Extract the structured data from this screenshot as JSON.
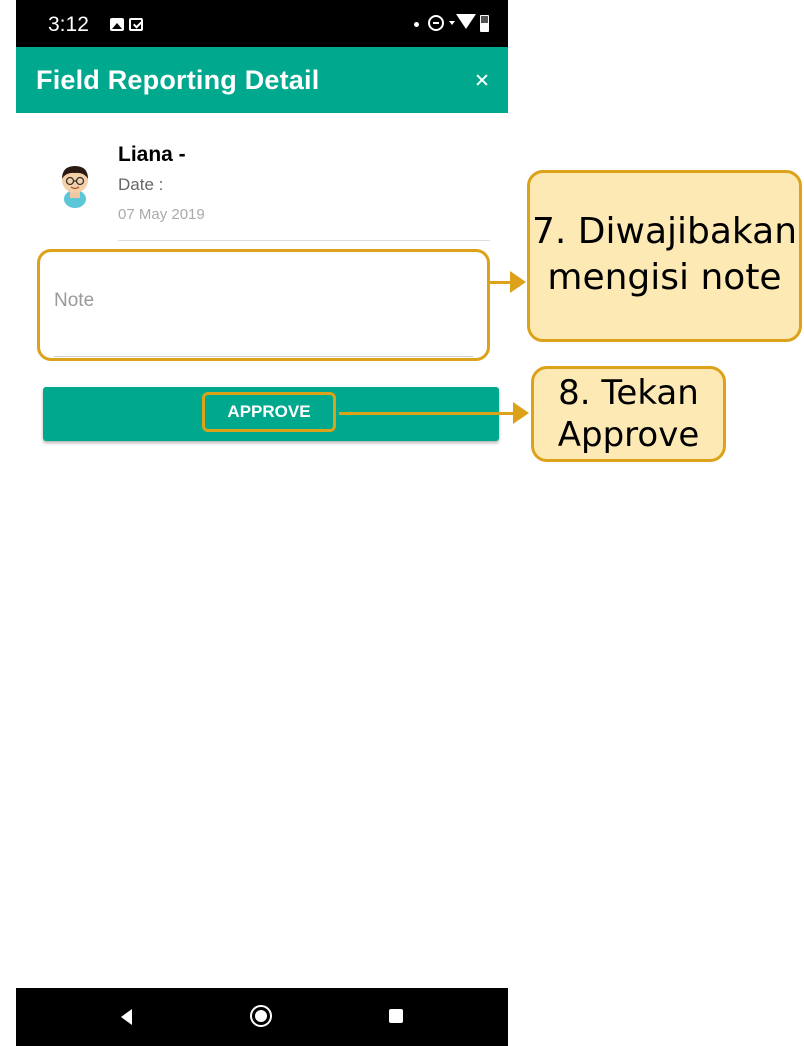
{
  "status_bar": {
    "time": "3:12",
    "icons": [
      "image-notification-icon",
      "mail-notification-icon",
      "dot-icon",
      "do-not-disturb-icon",
      "data-arrow-icon",
      "wifi-icon",
      "battery-icon"
    ]
  },
  "app_bar": {
    "title": "Field Reporting Detail",
    "close_icon": "close-icon",
    "color": "#00a88e"
  },
  "report": {
    "avatar_icon": "person-avatar-icon",
    "user_name": "Liana -",
    "date_label": "Date :",
    "date_value": "07 May 2019"
  },
  "note": {
    "placeholder": "Note",
    "value": ""
  },
  "approve_button": {
    "label": "APPROVE"
  },
  "nav_bar": {
    "icons": [
      "back-icon",
      "home-icon",
      "recents-icon"
    ]
  },
  "annotations": {
    "step7": [
      "7. Diwajibakan",
      "mengisi note"
    ],
    "step8": [
      "8. Tekan",
      "Approve"
    ],
    "highlight_color": "#dba21a",
    "callout_fill": "#fde9b4"
  }
}
